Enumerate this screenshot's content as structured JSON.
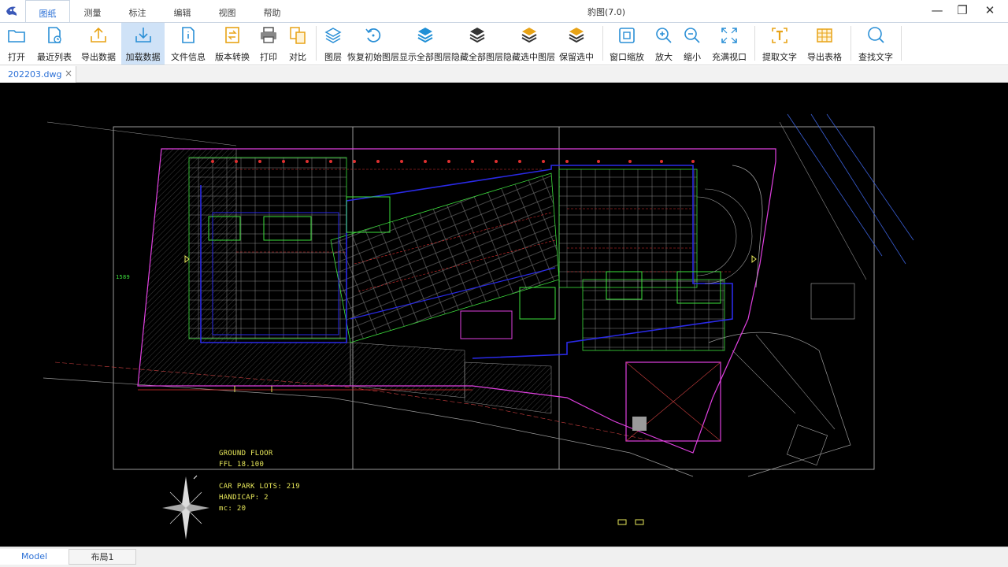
{
  "window": {
    "title": "豹图(7.0)",
    "minimize": "—",
    "maximize": "❐",
    "close": "✕"
  },
  "menu_tabs": [
    "图纸",
    "测量",
    "标注",
    "编辑",
    "视图",
    "帮助"
  ],
  "ribbon": {
    "open": "打开",
    "recent": "最近列表",
    "export_data": "导出数据",
    "load_data": "加载数据",
    "file_info": "文件信息",
    "version_convert": "版本转换",
    "print": "打印",
    "compare": "对比",
    "layers": "图层",
    "restore_layers": "恢复初始图层",
    "show_all_layers": "显示全部图层",
    "hide_all_layers": "隐藏全部图层",
    "hide_selected_layers": "隐藏选中图层",
    "keep_selected": "保留选中",
    "window_zoom": "窗口缩放",
    "zoom_in": "放大",
    "zoom_out": "缩小",
    "fit_view": "充满视口",
    "extract_text": "提取文字",
    "export_table": "导出表格",
    "find_text": "查找文字"
  },
  "document_tab": {
    "label": "202203.dwg",
    "close": "×"
  },
  "drawing": {
    "ground_floor": "GROUND FLOOR",
    "ffl": "FFL 18.100",
    "car_park": "CAR PARK LOTS: 219",
    "handicap": "HANDICAP: 2",
    "mc": "mc:   20",
    "dimension": "1589"
  },
  "layout_tabs": {
    "model": "Model",
    "layout1": "布局1"
  },
  "colors": {
    "accent": "#2a6fd6",
    "cad_yellow": "#e8e85a",
    "cad_magenta": "#e040e0",
    "cad_green": "#3de03d",
    "cad_blue": "#2a2ae8"
  }
}
